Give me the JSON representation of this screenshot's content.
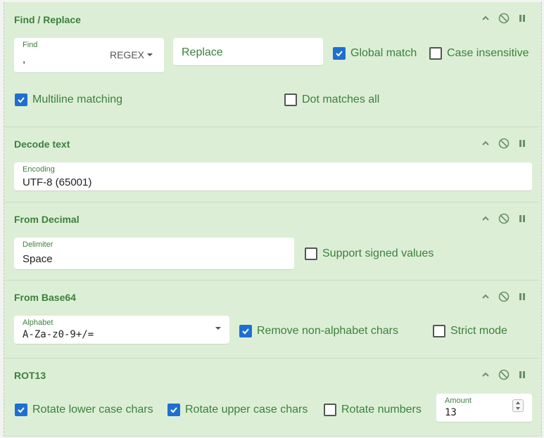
{
  "find_replace": {
    "title": "Find / Replace",
    "find_label": "Find",
    "find_value": ",",
    "find_mode": "REGEX",
    "replace_placeholder": "Replace",
    "options": [
      {
        "label": "Global match",
        "checked": true
      },
      {
        "label": "Case insensitive",
        "checked": false
      },
      {
        "label": "Multiline matching",
        "checked": true
      },
      {
        "label": "Dot matches all",
        "checked": false
      }
    ]
  },
  "decode_text": {
    "title": "Decode text",
    "encoding_label": "Encoding",
    "encoding_value": "UTF-8 (65001)"
  },
  "from_decimal": {
    "title": "From Decimal",
    "delimiter_label": "Delimiter",
    "delimiter_value": "Space",
    "signed_label": "Support signed values",
    "signed_checked": false
  },
  "from_base64": {
    "title": "From Base64",
    "alphabet_label": "Alphabet",
    "alphabet_value": "A-Za-z0-9+/=",
    "remove_label": "Remove non-alphabet chars",
    "remove_checked": true,
    "strict_label": "Strict mode",
    "strict_checked": false
  },
  "rot13": {
    "title": "ROT13",
    "lower_label": "Rotate lower case chars",
    "lower_checked": true,
    "upper_label": "Rotate upper case chars",
    "upper_checked": true,
    "numbers_label": "Rotate numbers",
    "numbers_checked": false,
    "amount_label": "Amount",
    "amount_value": "13"
  },
  "colors": {
    "accent_green": "#3d7f3d",
    "panel_bg": "#dcefd6",
    "checkbox_blue": "#1f6fd1"
  },
  "icons": [
    "chevron-up-icon",
    "disable-icon",
    "pause-icon",
    "checkmark-icon",
    "dropdown-caret-icon",
    "spinner-icon"
  ]
}
